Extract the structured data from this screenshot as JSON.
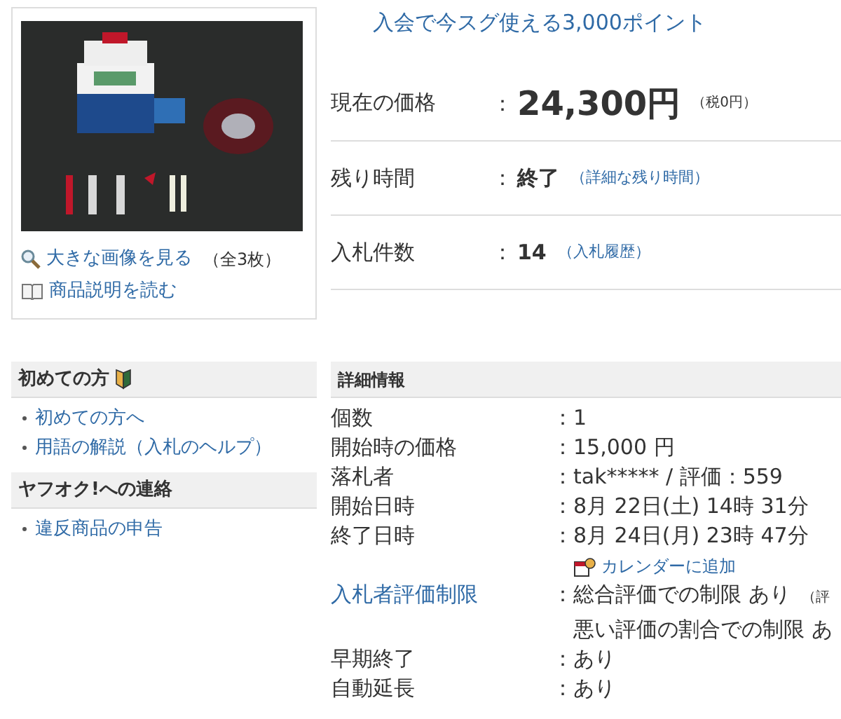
{
  "image_box": {
    "links": [
      {
        "kind": "zoom",
        "text": "大きな画像を見る",
        "note": "（全3枚）"
      },
      {
        "kind": "book",
        "text": "商品説明を読む"
      }
    ]
  },
  "promo": "入会で今スグ使える3,000ポイント",
  "summary": [
    {
      "label": "現在の価格",
      "sep": "：",
      "value": "24,300円",
      "note": "（税0円）",
      "kind": "price"
    },
    {
      "label": "残り時間",
      "sep": "：",
      "value": "終了",
      "note": "（詳細な残り時間）",
      "kind": "link"
    },
    {
      "label": "入札件数",
      "sep": "：",
      "value": "14",
      "note": "（入札履歴）",
      "kind": "link"
    }
  ],
  "sidebar": [
    {
      "title": "初めての方",
      "badge": true,
      "links": [
        "初めての方へ",
        "用語の解説（入札のヘルプ）"
      ]
    },
    {
      "title": "ヤフオク!への連絡",
      "badge": false,
      "links": [
        "違反商品の申告"
      ]
    }
  ],
  "details": {
    "title": "詳細情報",
    "rows": [
      {
        "label": "個数",
        "sep": "：",
        "values": [
          "1"
        ]
      },
      {
        "label": "開始時の価格",
        "sep": "：",
        "values": [
          "15,000 円"
        ]
      },
      {
        "label": "落札者",
        "sep": "：",
        "values": [
          "tak***** / 評価：559"
        ]
      },
      {
        "label": "開始日時",
        "sep": "：",
        "values": [
          "8月 22日(土) 14時 31分"
        ]
      },
      {
        "label": "終了日時",
        "sep": "：",
        "values": [
          "8月 24日(月) 23時 47分"
        ],
        "extra": "カレンダーに追加"
      },
      {
        "label": "入札者評価制限",
        "label_link": true,
        "sep": "：",
        "values": [
          "総合評価での制限 あり",
          "悪い評価の割合での制限 あ"
        ],
        "note": "（評"
      },
      {
        "label": "早期終了",
        "sep": "：",
        "values": [
          "あり"
        ]
      },
      {
        "label": "自動延長",
        "sep": "：",
        "values": [
          "あり"
        ]
      }
    ]
  }
}
